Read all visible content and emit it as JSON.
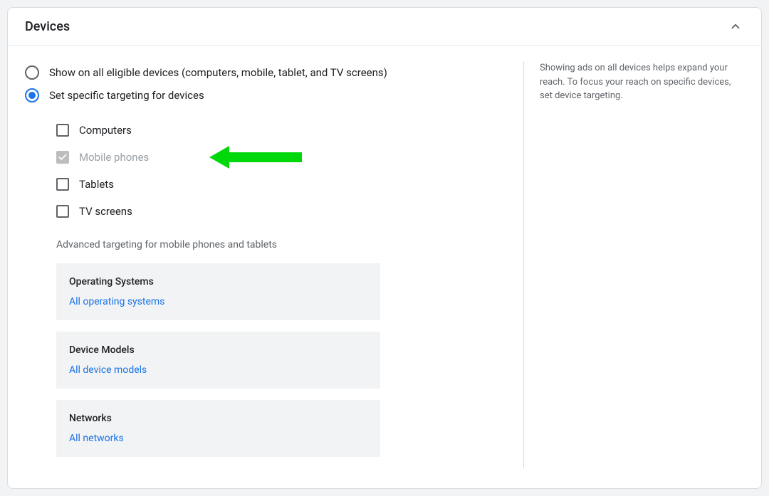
{
  "header": {
    "title": "Devices"
  },
  "radios": {
    "all": {
      "label": "Show on all eligible devices (computers, mobile, tablet, and TV screens)",
      "selected": false
    },
    "specific": {
      "label": "Set specific targeting for devices",
      "selected": true
    }
  },
  "checkboxes": {
    "computers": {
      "label": "Computers"
    },
    "mobile": {
      "label": "Mobile phones"
    },
    "tablets": {
      "label": "Tablets"
    },
    "tv": {
      "label": "TV screens"
    }
  },
  "advanced": {
    "heading": "Advanced targeting for mobile phones and tablets",
    "os": {
      "title": "Operating Systems",
      "link": "All operating systems"
    },
    "models": {
      "title": "Device Models",
      "link": "All device models"
    },
    "networks": {
      "title": "Networks",
      "link": "All networks"
    }
  },
  "help": {
    "text": "Showing ads on all devices helps expand your reach. To focus your reach on specific devices, set device targeting."
  }
}
